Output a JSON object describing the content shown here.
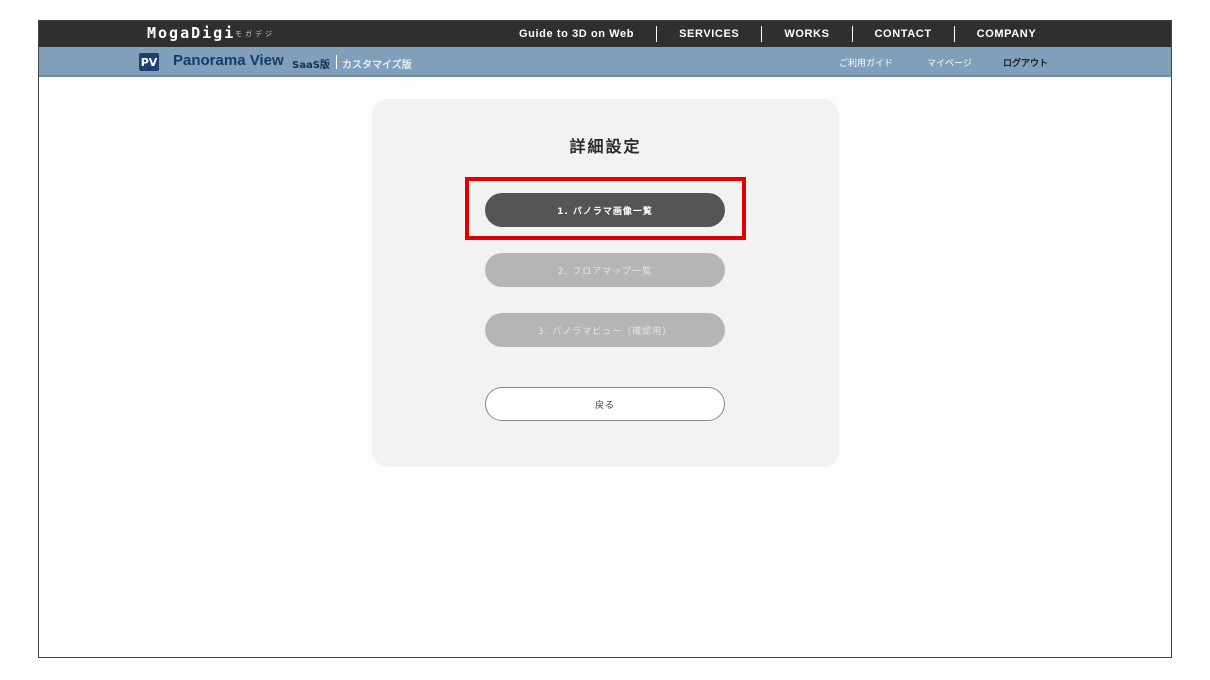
{
  "brand": {
    "name": "MogaDigi",
    "sub": "モガデジ"
  },
  "topnav": [
    "Guide to 3D on Web",
    "SERVICES",
    "WORKS",
    "CONTACT",
    "COMPANY"
  ],
  "product": {
    "badge": "PV",
    "name": "Panorama View",
    "edition": "SaaS版",
    "edition_alt": "カスタマイズ版"
  },
  "subnav": {
    "guide": "ご利用ガイド",
    "mypage": "マイページ",
    "logout": "ログアウト"
  },
  "panel": {
    "title": "詳細設定",
    "buttons": [
      {
        "label": "1. パノラマ画像一覧",
        "state": "active"
      },
      {
        "label": "2. フロアマップ一覧",
        "state": "disabled"
      },
      {
        "label": "3. パノラマビュー（確認用）",
        "state": "disabled"
      }
    ],
    "back": "戻る"
  },
  "colors": {
    "topbar": "#2f2f2f",
    "subbar": "#7f9fbb",
    "brand_dark": "#1f3f73",
    "highlight": "#e00000"
  }
}
